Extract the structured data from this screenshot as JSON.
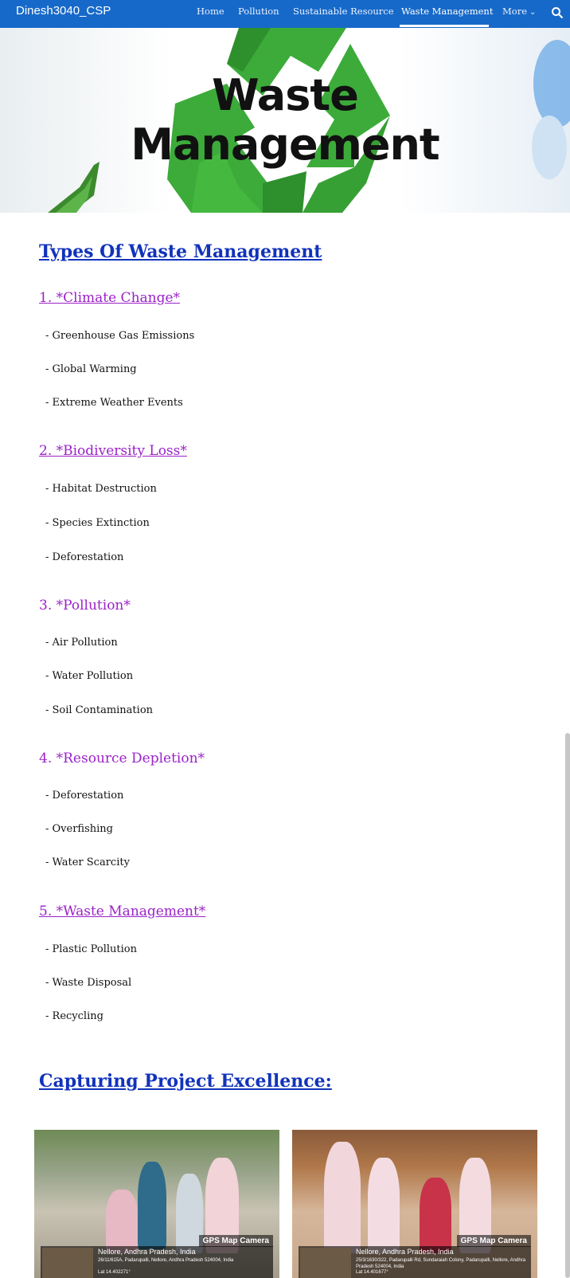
{
  "nav": {
    "brand": "Dinesh3040_CSP",
    "items": [
      "Home",
      "Pollution",
      "Sustainable Resource",
      "Waste Management",
      "More"
    ],
    "active": "Waste Management"
  },
  "hero": {
    "line1": "Waste",
    "line2": "Management"
  },
  "content": {
    "heading": "Types Of Waste Management",
    "sections": [
      {
        "title": "1. *Climate Change*",
        "items": [
          "- Greenhouse Gas Emissions",
          "- Global Warming",
          "- Extreme Weather Events"
        ]
      },
      {
        "title": "2. *Biodiversity Loss*",
        "items": [
          "- Habitat Destruction",
          "- Species Extinction",
          "- Deforestation"
        ]
      },
      {
        "title": "3. *Pollution*",
        "items": [
          "- Air Pollution",
          "- Water Pollution",
          "- Soil Contamination"
        ]
      },
      {
        "title": "4. *Resource Depletion*",
        "items": [
          "- Deforestation",
          "- Overfishing",
          "- Water Scarcity"
        ]
      },
      {
        "title": "5. *Waste Management*",
        "items": [
          "- Plastic Pollution",
          "- Waste Disposal",
          "- Recycling"
        ]
      }
    ],
    "heading2": "Capturing Project Excellence:"
  },
  "photos": [
    {
      "tag": "GPS Map Camera",
      "city": "Nellore, Andhra Pradesh, India",
      "address": "26/11/615A, Padarupalli, Nellore, Andhra Pradesh 524004, India",
      "lat": "Lat 14.402271°"
    },
    {
      "tag": "GPS Map Camera",
      "city": "Nellore, Andhra Pradesh, India",
      "address": "25/3/1630/322, Padarupalli Rd, Sundaraiah Colony, Padarupalli, Nellore, Andhra Pradesh 524004, India",
      "lat": "Lat 14.401677°"
    }
  ],
  "colors": {
    "nav": "#1769c9",
    "heading": "#1133bb",
    "section_title": "#9b22c8",
    "recycle_green": "#3cab3a"
  }
}
